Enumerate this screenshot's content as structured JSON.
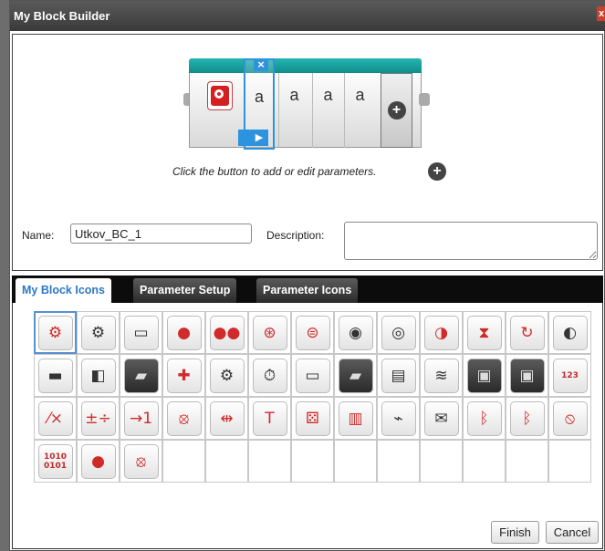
{
  "window": {
    "title": "My Block Builder",
    "close_glyph": "x"
  },
  "builder": {
    "block_icon": "red-head-gears-icon",
    "param_labels": [
      "a",
      "a",
      "a",
      "a"
    ],
    "selected_param_close": "×",
    "selected_param_tab": "▶",
    "add_param_glyph": "+",
    "hint": "Click the button to add or edit parameters.",
    "hint_plus_glyph": "+"
  },
  "form": {
    "name_label": "Name:",
    "name_value": "Utkov_BC_1",
    "description_label": "Description:",
    "description_value": ""
  },
  "tabs": [
    {
      "label": "My Block Icons",
      "active": true
    },
    {
      "label": "Parameter Setup",
      "active": false
    },
    {
      "label": "Parameter Icons",
      "active": false
    }
  ],
  "icons": [
    {
      "name": "red-head-gears-icon",
      "glyph": "⚙",
      "style": "red",
      "selected": true
    },
    {
      "name": "gray-head-gears-icon",
      "glyph": "⚙",
      "style": ""
    },
    {
      "name": "large-motor-icon",
      "glyph": "▭",
      "style": ""
    },
    {
      "name": "motor-red-hub-icon",
      "glyph": "●",
      "style": "red"
    },
    {
      "name": "move-steering-icon",
      "glyph": "●●",
      "style": "red"
    },
    {
      "name": "steering-wheel-motors-icon",
      "glyph": "⊛",
      "style": "red"
    },
    {
      "name": "tank-motors-icon",
      "glyph": "⊜",
      "style": "red"
    },
    {
      "name": "display-screen-icon",
      "glyph": "◉",
      "style": ""
    },
    {
      "name": "speaker-icon",
      "glyph": "◎",
      "style": ""
    },
    {
      "name": "brick-status-light-icon",
      "glyph": "◑",
      "style": "red"
    },
    {
      "name": "hourglass-icon",
      "glyph": "⧗",
      "style": "red"
    },
    {
      "name": "loop-icon",
      "glyph": "↻",
      "style": "red"
    },
    {
      "name": "color-sensor-icon",
      "glyph": "◐",
      "style": ""
    },
    {
      "name": "touch-sensor-icon",
      "glyph": "▬",
      "style": ""
    },
    {
      "name": "gyro-sensor-icon",
      "glyph": "◧",
      "style": ""
    },
    {
      "name": "infrared-sensor-icon",
      "glyph": "▰",
      "style": "dark"
    },
    {
      "name": "brick-buttons-icon",
      "glyph": "✚",
      "style": "red"
    },
    {
      "name": "motor-rotation-icon",
      "glyph": "⚙",
      "style": ""
    },
    {
      "name": "timer-icon",
      "glyph": "⏱",
      "style": ""
    },
    {
      "name": "ultrasonic-sensor-icon",
      "glyph": "▭",
      "style": ""
    },
    {
      "name": "infrared-beacon-icon",
      "glyph": "▰",
      "style": "dark"
    },
    {
      "name": "temperature-sensor-icon",
      "glyph": "▤",
      "style": ""
    },
    {
      "name": "energy-meter-icon",
      "glyph": "≋",
      "style": ""
    },
    {
      "name": "briefcase-icon",
      "glyph": "▣",
      "style": "dark"
    },
    {
      "name": "locked-briefcase-icon",
      "glyph": "▣",
      "style": "dark"
    },
    {
      "name": "array-operations-icon",
      "glyph": "123",
      "style": "bin"
    },
    {
      "name": "logic-operations-icon",
      "glyph": "⁄×",
      "style": "red"
    },
    {
      "name": "math-icon",
      "glyph": "±÷",
      "style": "red"
    },
    {
      "name": "round-icon",
      "glyph": "→1",
      "style": "red"
    },
    {
      "name": "compare-icon",
      "glyph": "⦻",
      "style": "red"
    },
    {
      "name": "range-icon",
      "glyph": "⇹",
      "style": "red"
    },
    {
      "name": "text-icon",
      "glyph": "T",
      "style": "red"
    },
    {
      "name": "random-dice-icon",
      "glyph": "⚄",
      "style": "red"
    },
    {
      "name": "file-access-icon",
      "glyph": "▥",
      "style": "red"
    },
    {
      "name": "datalogging-icon",
      "glyph": "⌁",
      "style": ""
    },
    {
      "name": "messaging-icon",
      "glyph": "✉",
      "style": ""
    },
    {
      "name": "bluetooth-icon",
      "glyph": "ᛒ",
      "style": "red"
    },
    {
      "name": "bluetooth-settings-icon",
      "glyph": "ᛒ",
      "style": "red"
    },
    {
      "name": "keep-awake-icon",
      "glyph": "⦸",
      "style": "red"
    },
    {
      "name": "raw-sensor-value-icon",
      "glyph": "1010 0101",
      "style": "bin"
    },
    {
      "name": "unregulated-motor-icon",
      "glyph": "●",
      "style": "red"
    },
    {
      "name": "invert-motor-icon",
      "glyph": "⦻",
      "style": "red"
    }
  ],
  "footer": {
    "finish_label": "Finish",
    "cancel_label": "Cancel"
  }
}
